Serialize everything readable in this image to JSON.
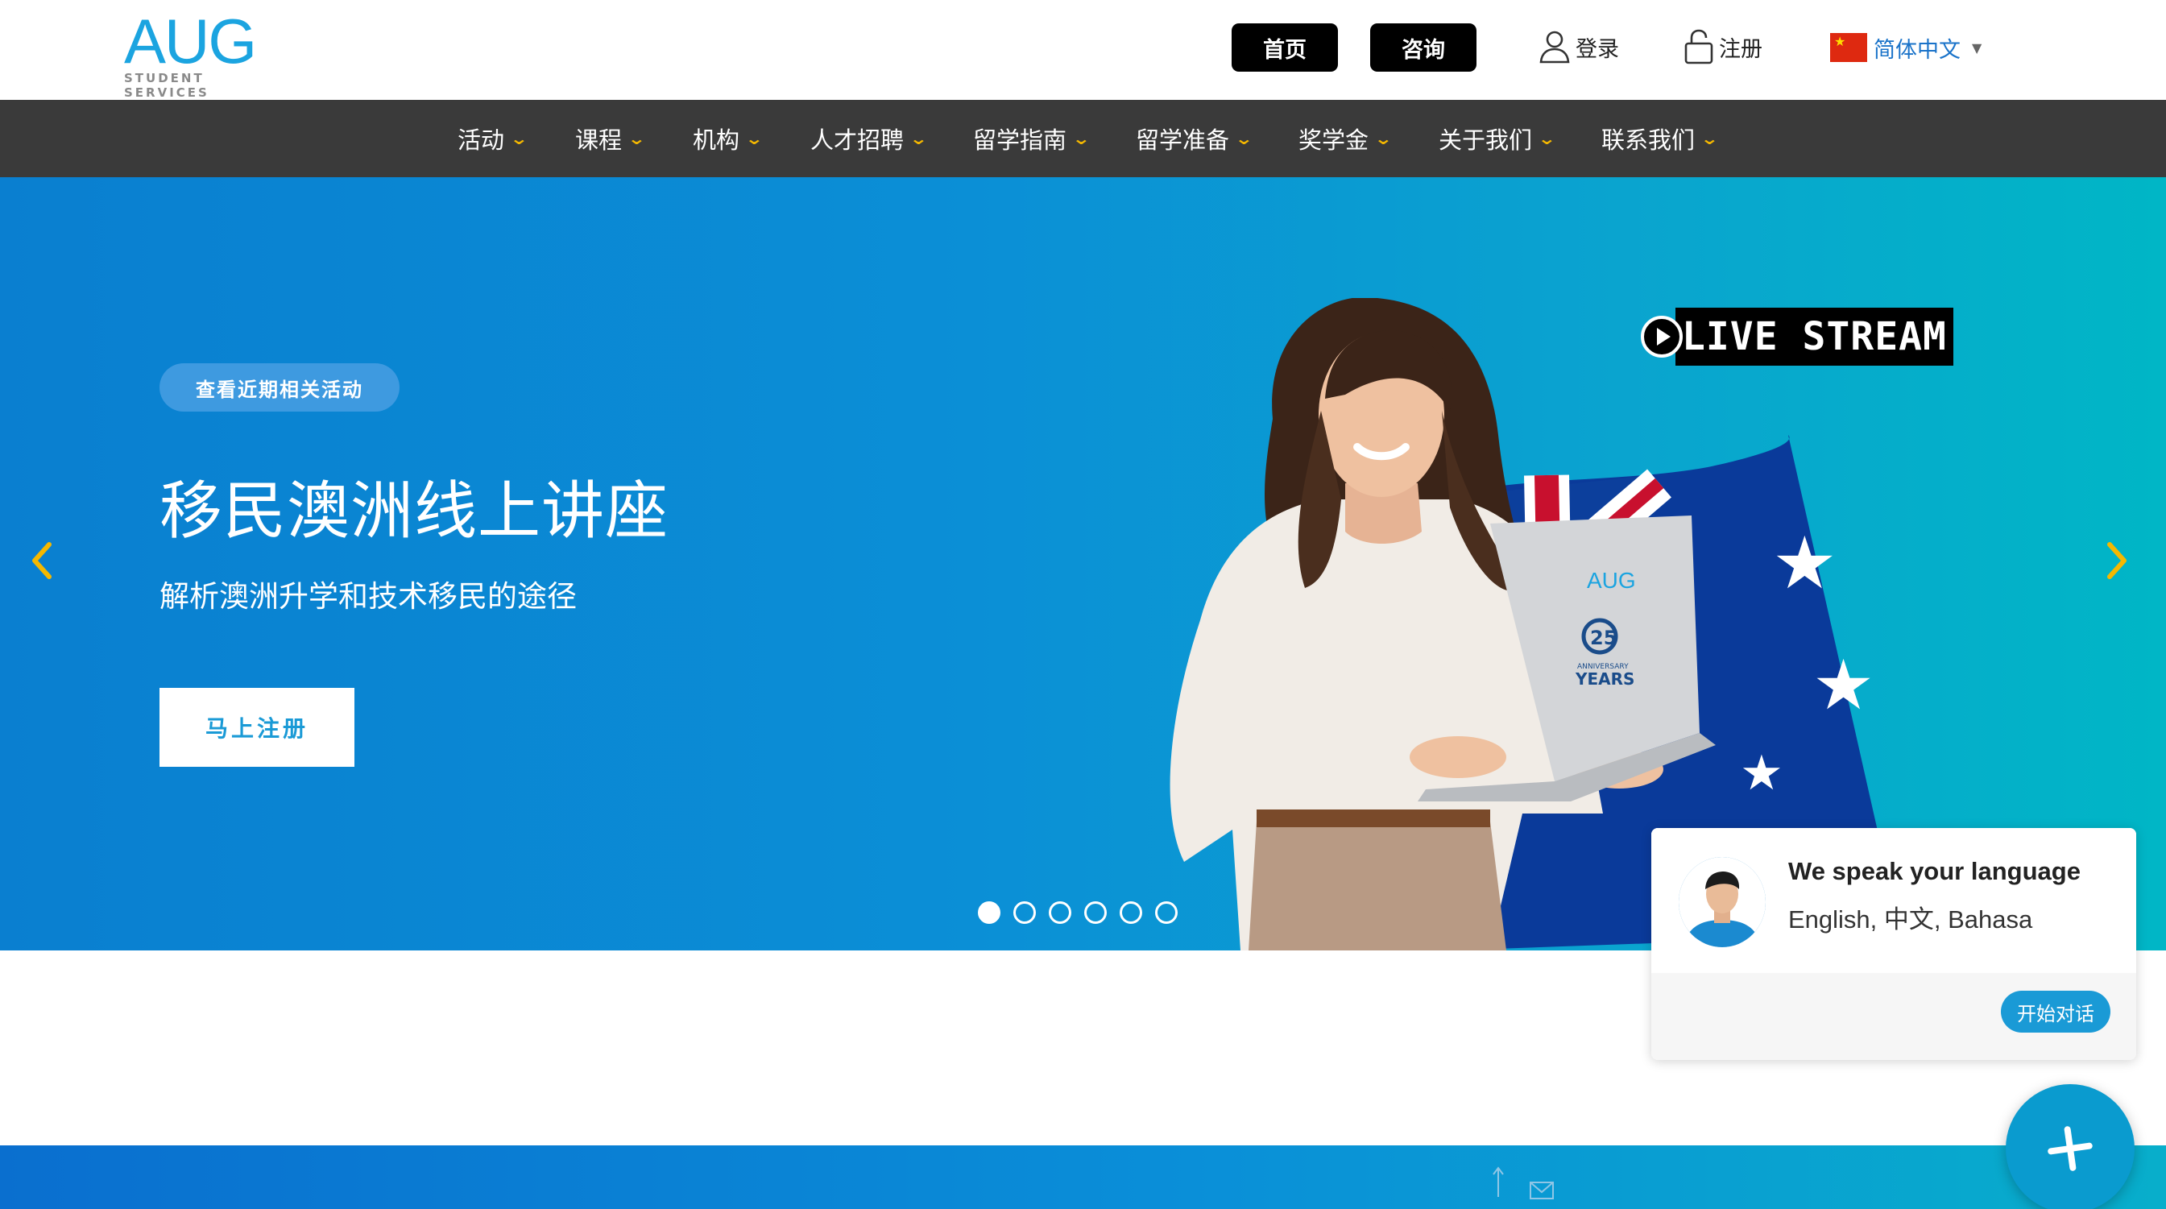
{
  "header": {
    "logo_text": "AUG",
    "logo_subtitle": "STUDENT SERVICES",
    "buttons": [
      {
        "label": "首页"
      },
      {
        "label": "咨询"
      }
    ],
    "login_label": "登录",
    "register_label": "注册",
    "language": {
      "selected": "简体中文",
      "flag": "china-flag-icon"
    }
  },
  "nav": {
    "items": [
      {
        "label": "活动"
      },
      {
        "label": "课程"
      },
      {
        "label": "机构"
      },
      {
        "label": "人才招聘"
      },
      {
        "label": "留学指南"
      },
      {
        "label": "留学准备"
      },
      {
        "label": "奖学金"
      },
      {
        "label": "关于我们"
      },
      {
        "label": "联系我们"
      }
    ]
  },
  "hero": {
    "pill_label": "查看近期相关活动",
    "title": "移民澳洲线上讲座",
    "subtitle": "解析澳洲升学和技术移民的途径",
    "cta_label": "马上注册",
    "live_stream_badge": "LIVE STREAM",
    "laptop_brand": "AUG",
    "laptop_text_number": "25",
    "laptop_text_small": "ANNIVERSARY",
    "laptop_text_years": "YEARS",
    "slides_total": 6,
    "active_slide": 1
  },
  "chat_widget": {
    "title": "We speak your language",
    "languages": "English, 中文, Bahasa",
    "button_label": "开始对话"
  },
  "colors": {
    "nav_bg": "#3a3a3a",
    "accent_yellow": "#f5b800",
    "brand_blue": "#1a9ad6",
    "logo_blue": "#1ba4e0"
  }
}
